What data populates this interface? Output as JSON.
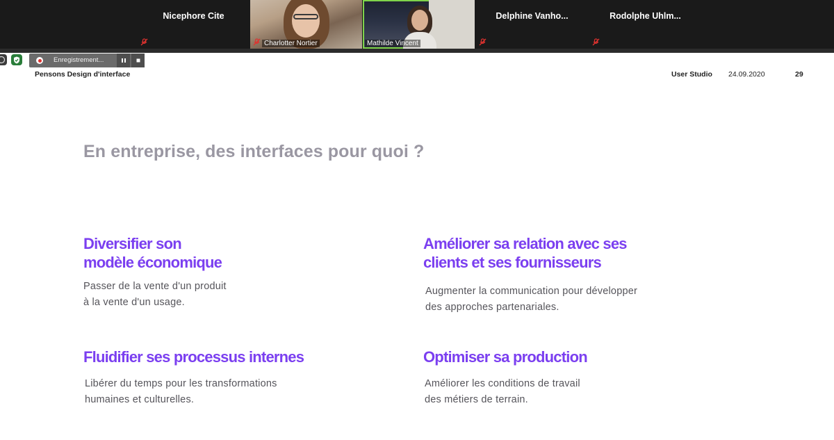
{
  "participants": [
    {
      "name": "Nicephore Cite",
      "video": false
    },
    {
      "name": "Charlotter Nortier",
      "video": true
    },
    {
      "name": "Mathilde Vincent",
      "video": true
    },
    {
      "name": "Delphine Vanho...",
      "video": false
    },
    {
      "name": "Rodolphe Uhlm...",
      "video": false
    }
  ],
  "recording": {
    "label": "Enregistrement...",
    "pause_icon": "pause-icon",
    "stop_icon": "stop-icon"
  },
  "slide": {
    "header_left": "Pensons Design d'interface",
    "studio": "User Studio",
    "date": "24.09.2020",
    "page": "29",
    "title": "En entreprise, des interfaces pour quoi ?",
    "blocks": [
      {
        "heading1": "Diversifier son",
        "heading2": "modèle économique",
        "line1": "Passer de la vente d'un produit",
        "line2": "à la vente d'un usage."
      },
      {
        "heading1": "Améliorer sa relation avec ses",
        "heading2": "clients et ses fournisseurs",
        "line1": "Augmenter la communication pour développer",
        "line2": "des approches partenariales."
      },
      {
        "heading1": "Fluidifier ses processus internes",
        "line1": "Libérer du temps pour les transformations",
        "line2": "humaines et culturelles."
      },
      {
        "heading1": "Optimiser sa production",
        "line1": "Améliorer les conditions de travail",
        "line2": "des métiers de terrain."
      }
    ]
  },
  "colors": {
    "accent": "#7b3ff0",
    "title_gray": "#9a97a2",
    "body_text": "#55545a",
    "muted_red": "#e0322f",
    "active_speaker": "#7fd44b"
  }
}
